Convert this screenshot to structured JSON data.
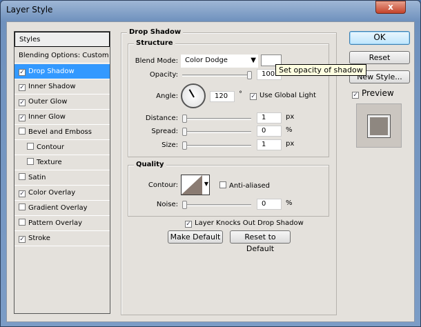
{
  "window": {
    "title": "Layer Style",
    "close": "x"
  },
  "sidebar": {
    "items": [
      {
        "label": "Styles",
        "checkbox": false,
        "checked": false
      },
      {
        "label": "Blending Options: Custom",
        "checkbox": false,
        "checked": false
      },
      {
        "label": "Drop Shadow",
        "checkbox": true,
        "checked": true,
        "selected": true
      },
      {
        "label": "Inner Shadow",
        "checkbox": true,
        "checked": true
      },
      {
        "label": "Outer Glow",
        "checkbox": true,
        "checked": true
      },
      {
        "label": "Inner Glow",
        "checkbox": true,
        "checked": true
      },
      {
        "label": "Bevel and Emboss",
        "checkbox": true,
        "checked": false
      },
      {
        "label": "Contour",
        "checkbox": true,
        "checked": false,
        "indent": true
      },
      {
        "label": "Texture",
        "checkbox": true,
        "checked": false,
        "indent": true
      },
      {
        "label": "Satin",
        "checkbox": true,
        "checked": false
      },
      {
        "label": "Color Overlay",
        "checkbox": true,
        "checked": true
      },
      {
        "label": "Gradient Overlay",
        "checkbox": true,
        "checked": false
      },
      {
        "label": "Pattern Overlay",
        "checkbox": true,
        "checked": false
      },
      {
        "label": "Stroke",
        "checkbox": true,
        "checked": true
      }
    ]
  },
  "panel": {
    "title": "Drop Shadow",
    "structure": {
      "title": "Structure",
      "blend_mode_label": "Blend Mode:",
      "blend_mode": "Color Dodge",
      "shadow_color": "#ffffff",
      "opacity_label": "Opacity:",
      "opacity": "100",
      "opacity_unit": "%",
      "angle_label": "Angle:",
      "angle": "120",
      "angle_unit": "°",
      "use_global_light": "Use Global Light",
      "use_global_light_checked": true,
      "distance_label": "Distance:",
      "distance": "1",
      "distance_unit": "px",
      "spread_label": "Spread:",
      "spread": "0",
      "spread_unit": "%",
      "size_label": "Size:",
      "size": "1",
      "size_unit": "px"
    },
    "quality": {
      "title": "Quality",
      "contour_label": "Contour:",
      "anti_aliased": "Anti-aliased",
      "noise_label": "Noise:",
      "noise": "0",
      "noise_unit": "%"
    },
    "knockout": "Layer Knocks Out Drop Shadow",
    "make_default": "Make Default",
    "reset_default": "Reset to Default"
  },
  "buttons": {
    "ok": "OK",
    "reset": "Reset",
    "new_style": "New Style...",
    "preview": "Preview"
  },
  "tooltip": "Set opacity of shadow",
  "colors": {
    "selection": "#3399ff",
    "tooltip_bg": "#ffffe1"
  }
}
